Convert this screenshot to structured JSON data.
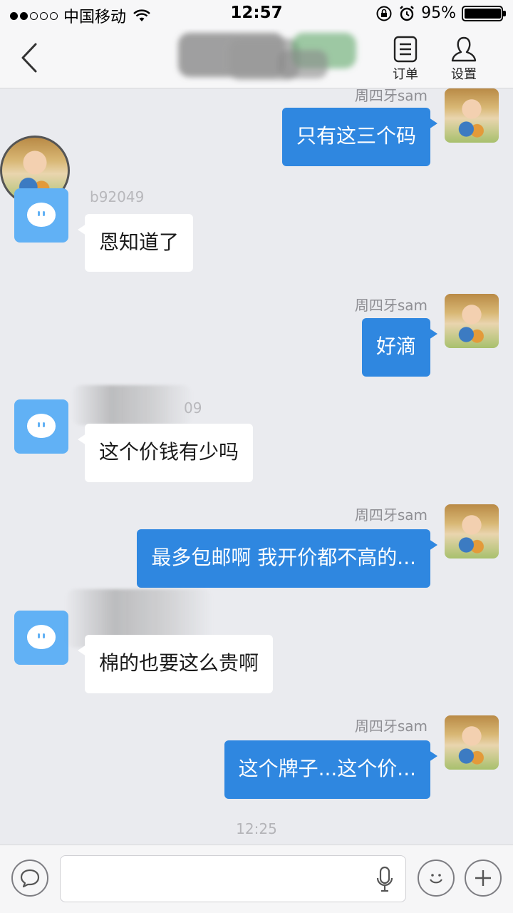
{
  "status_bar": {
    "carrier": "中国移动",
    "time": "12:57",
    "battery": "95%",
    "battery_level": 0.95
  },
  "nav": {
    "orders_label": "订单",
    "settings_label": "设置"
  },
  "messages": [
    {
      "direction": "out",
      "sender": "周四牙sam",
      "text": "只有这三个码"
    },
    {
      "direction": "in",
      "sender": "b92049",
      "text": "恩知道了"
    },
    {
      "direction": "out",
      "sender": "周四牙sam",
      "text": "好滴"
    },
    {
      "direction": "in",
      "sender": "09",
      "text": "这个价钱有少吗"
    },
    {
      "direction": "out",
      "sender": "周四牙sam",
      "text": "最多包邮啊 我开价都不高的..."
    },
    {
      "direction": "in",
      "sender": "",
      "text": "棉的也要这么贵啊"
    },
    {
      "direction": "out",
      "sender": "周四牙sam",
      "text": "这个牌子...这个价..."
    }
  ],
  "timestamp": "12:25",
  "icons": {
    "back": "chevron-left-icon",
    "orders": "document-icon",
    "settings": "person-icon",
    "voice": "chat-bubble-icon",
    "mic": "microphone-icon",
    "emoji": "smiley-icon",
    "more": "plus-icon"
  }
}
